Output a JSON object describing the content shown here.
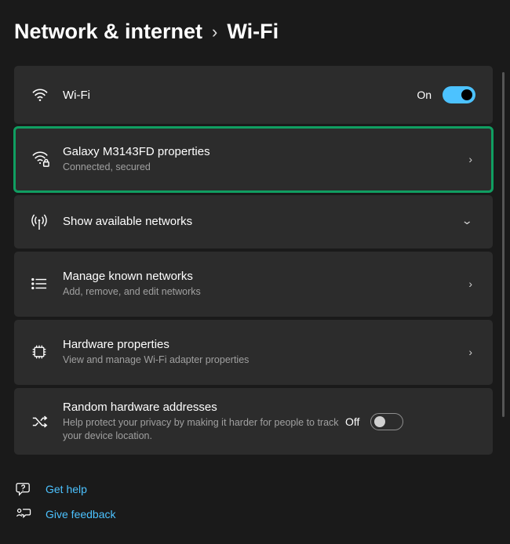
{
  "breadcrumb": {
    "parent": "Network & internet",
    "current": "Wi-Fi"
  },
  "wifi_toggle": {
    "label": "Wi-Fi",
    "state_text": "On",
    "on": true
  },
  "network_properties": {
    "title": "Galaxy M3143FD properties",
    "subtitle": "Connected, secured"
  },
  "show_available": {
    "title": "Show available networks"
  },
  "manage_known": {
    "title": "Manage known networks",
    "subtitle": "Add, remove, and edit networks"
  },
  "hardware_properties": {
    "title": "Hardware properties",
    "subtitle": "View and manage Wi-Fi adapter properties"
  },
  "random_mac": {
    "title": "Random hardware addresses",
    "subtitle": "Help protect your privacy by making it harder for people to track your device location.",
    "state_text": "Off",
    "on": false
  },
  "footer": {
    "get_help": "Get help",
    "give_feedback": "Give feedback"
  }
}
